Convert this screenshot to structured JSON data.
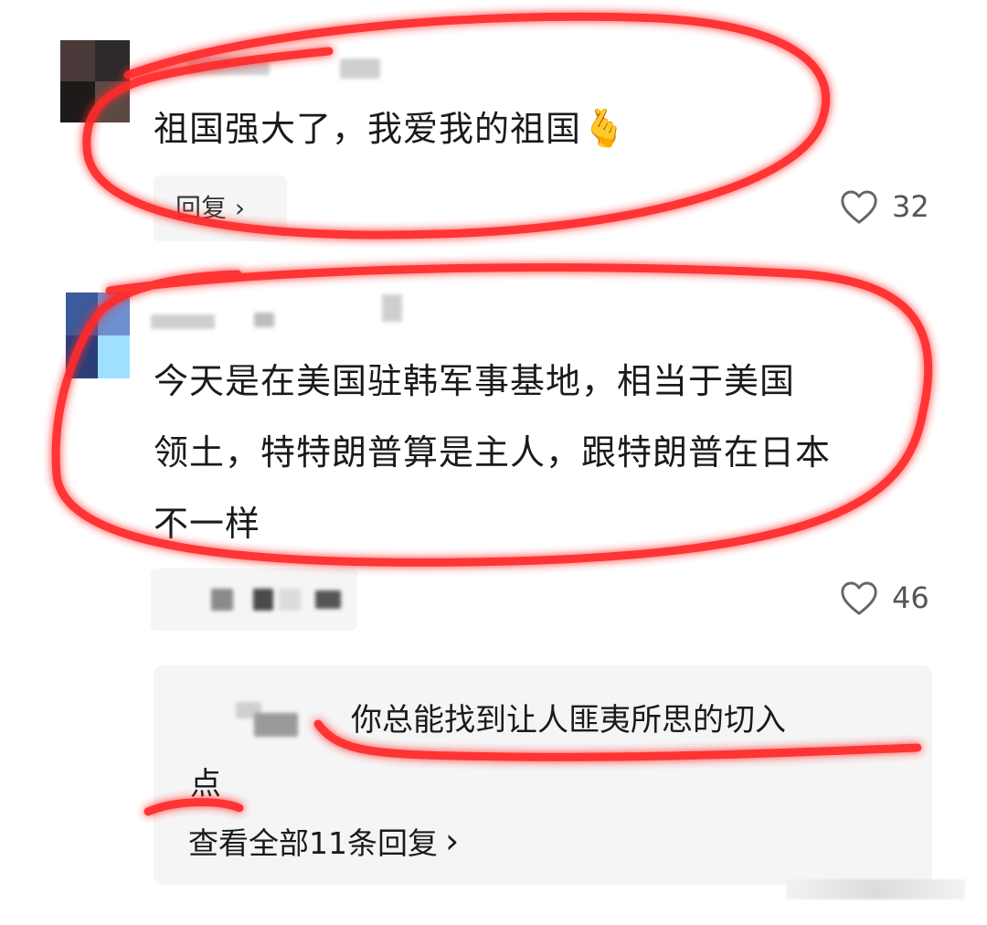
{
  "comments": [
    {
      "text": "祖国强大了，我爱我的祖国",
      "emoji": "🫰",
      "reply_label": "回复 ›",
      "likes": "32"
    },
    {
      "text_lines": [
        "今天是在美国驻韩军事基地，相当于美国",
        "领土，特特朗普算是主人，跟特朗普在日本",
        "不一样"
      ],
      "likes": "46"
    }
  ],
  "reply": {
    "text_line1": "你总能找到让人匪夷所思的切入",
    "text_line2": "点",
    "view_all": "查看全部11条回复",
    "view_all_chevron": "›"
  },
  "colors": {
    "annotation_red": "#ff2a2a",
    "reply_bg": "#f5f5f5",
    "icon_gray": "#666666"
  },
  "icons": {
    "like": "heart-outline-icon"
  }
}
